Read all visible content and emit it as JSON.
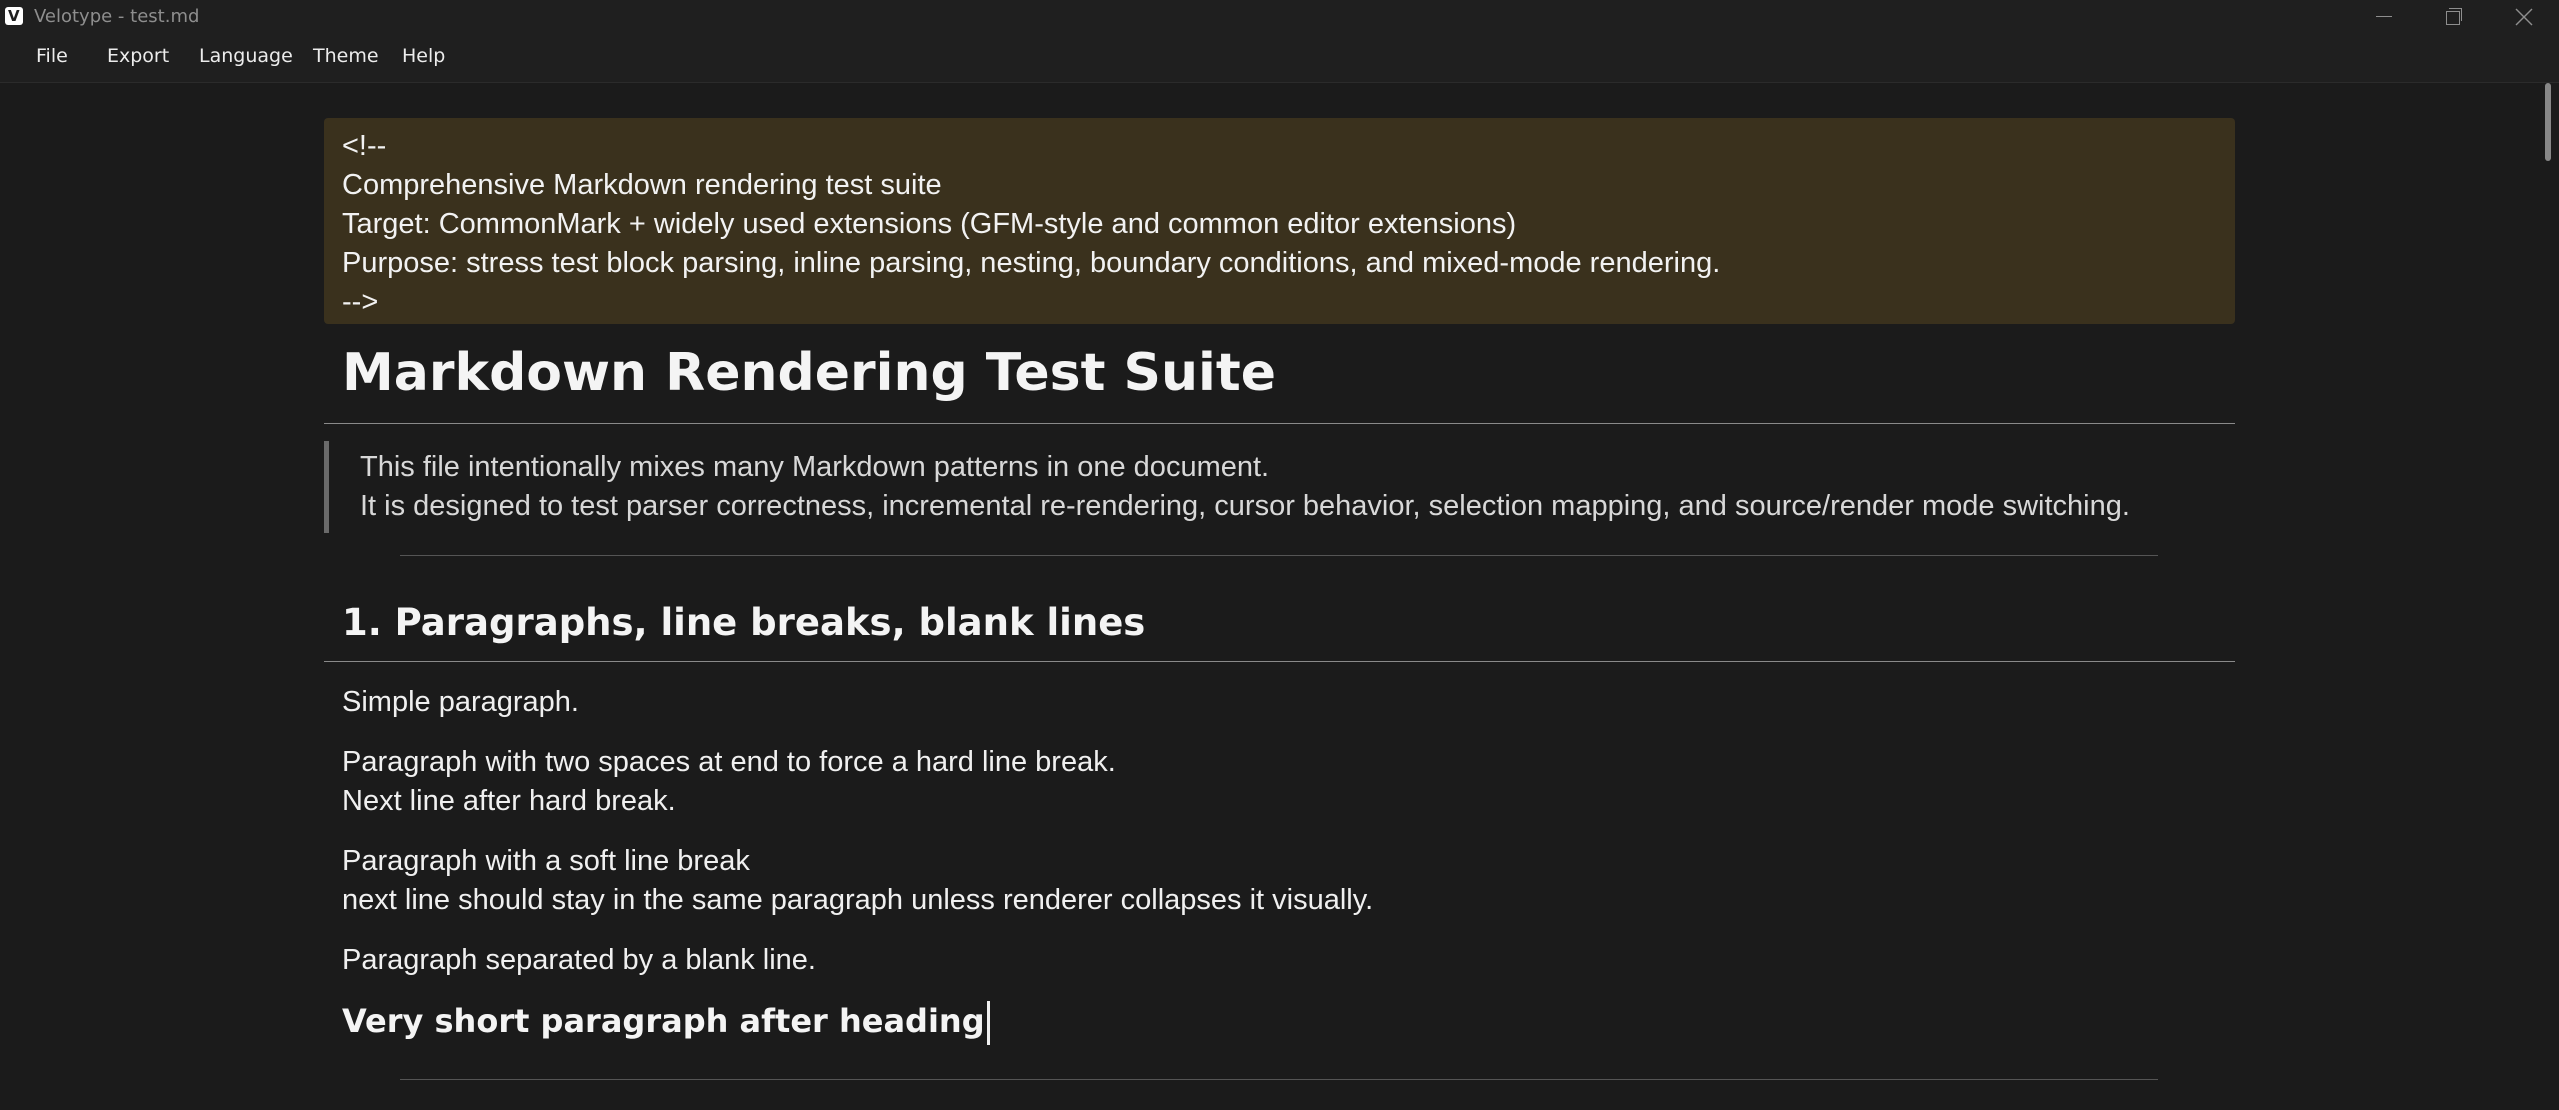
{
  "window": {
    "title": "Velotype - test.md",
    "icon": "velotype-logo-icon",
    "icon_letter": "V"
  },
  "menu": {
    "items": [
      {
        "label": "File"
      },
      {
        "label": "Export"
      },
      {
        "label": "Language"
      },
      {
        "label": "Theme"
      },
      {
        "label": "Help"
      }
    ]
  },
  "document": {
    "html_comment": [
      "<!--",
      "Comprehensive Markdown rendering test suite",
      "Target: CommonMark + widely used extensions (GFM-style and common editor extensions)",
      "Purpose: stress test block parsing, inline parsing, nesting, boundary conditions, and mixed-mode rendering.",
      "-->"
    ],
    "h1": "Markdown Rendering Test Suite",
    "blockquote": [
      "This file intentionally mixes many Markdown patterns in one document.",
      "It is designed to test parser correctness, incremental re-rendering, cursor behavior, selection mapping, and source/render mode switching."
    ],
    "h2": "1. Paragraphs, line breaks, blank lines",
    "paragraphs": [
      [
        "Simple paragraph."
      ],
      [
        "Paragraph with two spaces at end to force a hard line break.",
        "Next line after hard break."
      ],
      [
        "Paragraph with a soft line break",
        "next line should stay in the same paragraph unless renderer collapses it visually."
      ],
      [
        "Paragraph separated by a blank line."
      ]
    ],
    "h3": "Very short paragraph after heading"
  },
  "colors": {
    "background": "#1b1b1b",
    "chrome": "#1f1f1f",
    "comment_block": "#3a311d",
    "text": "#f0f0f0",
    "blockquote_bar": "#6a6a6a"
  }
}
